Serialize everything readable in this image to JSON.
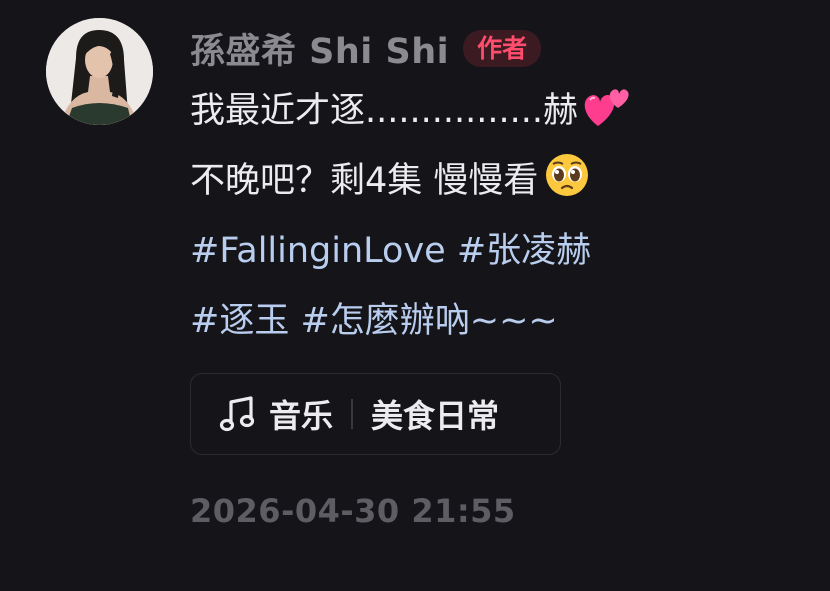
{
  "comment": {
    "avatar_icon": "user-avatar-photo",
    "username": "孫盛希 Shi Shi",
    "author_badge": "作者",
    "lines": [
      "我最近才逐................赫",
      "不晚吧？剩4集 慢慢看",
      "#FallinginLove #张凌赫",
      "#逐玉 #怎麼辦吶~~~"
    ],
    "emojis": [
      "two-hearts-emoji",
      "pleading-face-emoji"
    ],
    "tags": {
      "music_icon": "music-note-icon",
      "music_label": "音乐",
      "topic_label": "美食日常"
    },
    "timestamp": "2026-04-30 21:55",
    "colors": {
      "background": "#151419",
      "text": "#ecebef",
      "hashtag": "#b9cdee",
      "username": "#8b8a90",
      "badge_text": "#ff4d6d",
      "badge_bg": "#3c1a22",
      "timestamp": "#5e5d63"
    }
  }
}
